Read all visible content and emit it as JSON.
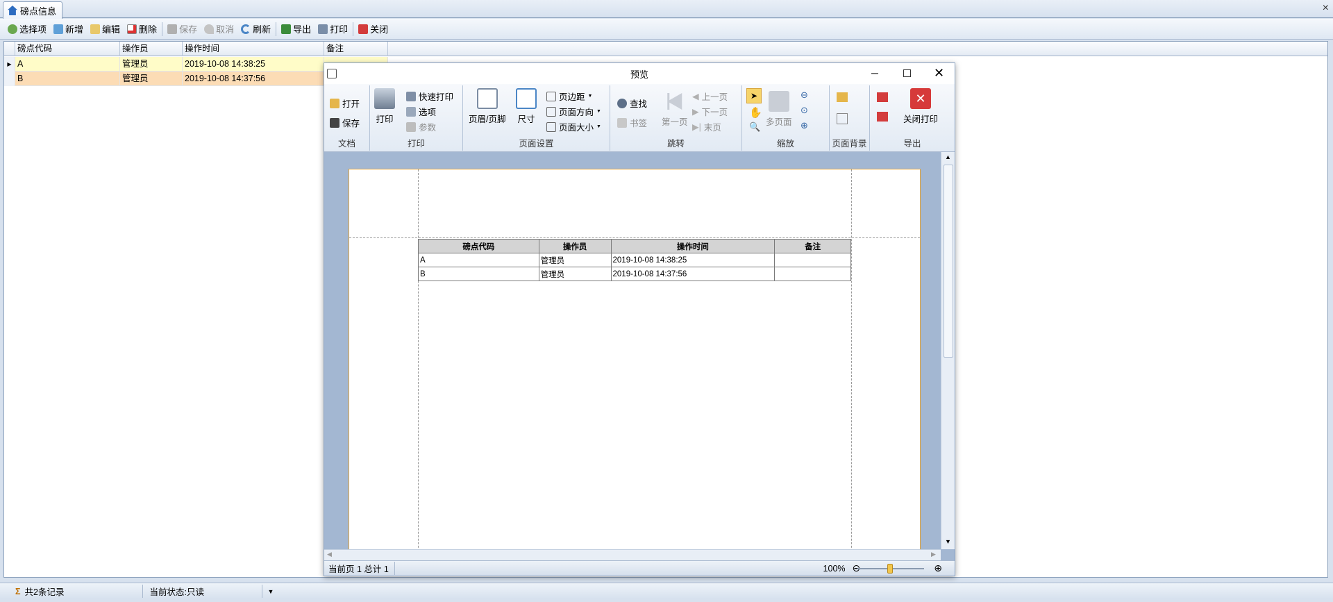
{
  "tab": {
    "title": "磅点信息",
    "close": "×"
  },
  "toolbar": {
    "select": "选择项",
    "add": "新增",
    "edit": "编辑",
    "delete": "删除",
    "save": "保存",
    "cancel": "取消",
    "refresh": "刷新",
    "export": "导出",
    "print": "打印",
    "close": "关闭"
  },
  "grid": {
    "columns": [
      "磅点代码",
      "操作员",
      "操作时间",
      "备注"
    ],
    "rows": [
      {
        "code": "A",
        "operator": "管理员",
        "time": "2019-10-08 14:38:25",
        "note": ""
      },
      {
        "code": "B",
        "operator": "管理员",
        "time": "2019-10-08 14:37:56",
        "note": ""
      }
    ]
  },
  "status": {
    "records": "共2条记录",
    "state": "当前状态:只读"
  },
  "preview": {
    "title": "预览",
    "ribbon": {
      "doc": {
        "open": "打开",
        "save": "保存",
        "label": "文档"
      },
      "print": {
        "print": "打印",
        "quick": "快速打印",
        "options": "选项",
        "params": "参数",
        "label": "打印"
      },
      "setup": {
        "header_footer": "页眉/页脚",
        "size": "尺寸",
        "margins": "页边距",
        "orientation": "页面方向",
        "page_size": "页面大小",
        "label": "页面设置"
      },
      "nav": {
        "find": "查找",
        "bookmark": "书签",
        "first": "第一页",
        "prev": "上一页",
        "next": "下一页",
        "last": "末页",
        "label": "跳转"
      },
      "zoom": {
        "multi": "多页面",
        "label": "缩放"
      },
      "bg": {
        "label": "页面背景"
      },
      "export": {
        "close_print": "关闭打印",
        "label": "导出"
      }
    },
    "table": {
      "columns": [
        "磅点代码",
        "操作员",
        "操作时间",
        "备注"
      ],
      "rows": [
        {
          "code": "A",
          "operator": "管理员",
          "time": "2019-10-08 14:38:25",
          "note": ""
        },
        {
          "code": "B",
          "operator": "管理员",
          "time": "2019-10-08 14:37:56",
          "note": ""
        }
      ]
    },
    "status": {
      "pages": "当前页 1 总计 1",
      "zoom": "100%"
    }
  }
}
